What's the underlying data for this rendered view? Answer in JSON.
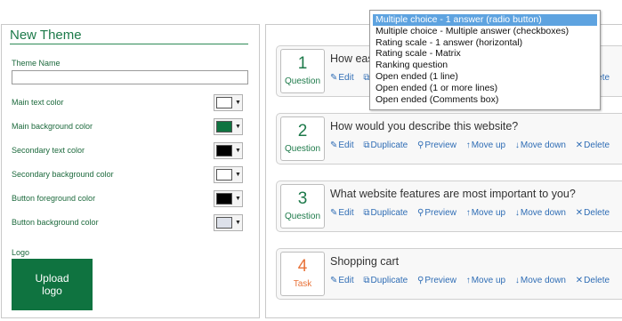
{
  "theme_panel": {
    "title": "New Theme",
    "theme_name_label": "Theme Name",
    "theme_name_value": "",
    "color_settings": [
      {
        "label": "Main text color",
        "color": "#ffffff"
      },
      {
        "label": "Main background color",
        "color": "#0f7340"
      },
      {
        "label": "Secondary text color",
        "color": "#000000"
      },
      {
        "label": "Secondary background color",
        "color": "#ffffff"
      },
      {
        "label": "Button foreground color",
        "color": "#000000"
      },
      {
        "label": "Button background color",
        "color": "#dde1ea"
      }
    ],
    "logo_label": "Logo",
    "upload_button_label": "Upload\nlogo"
  },
  "questions": [
    {
      "number": "1",
      "type": "Question",
      "text": "How easy was it to find what you were looking for",
      "accent": "#1d7a4a"
    },
    {
      "number": "2",
      "type": "Question",
      "text": "How would you describe this website?",
      "accent": "#1d7a4a"
    },
    {
      "number": "3",
      "type": "Question",
      "text": "What website features are most important to you?",
      "accent": "#1d7a4a"
    },
    {
      "number": "4",
      "type": "Task",
      "text": "Shopping cart",
      "accent": "#e8733a"
    }
  ],
  "actions": {
    "edit": "Edit",
    "duplicate": "Duplicate",
    "preview": "Preview",
    "move_up": "Move up",
    "move_down": "Move down",
    "delete": "Delete"
  },
  "action_icons": [
    "pencil-icon",
    "copy-icon",
    "magnifier-icon",
    "arrow-up-icon",
    "arrow-down-icon",
    "x-icon"
  ],
  "question_type_dropdown": {
    "options": [
      "Multiple choice - 1 answer (radio button)",
      "Multiple choice - Multiple answer (checkboxes)",
      "Rating scale - 1 answer (horizontal)",
      "Rating scale - Matrix",
      "Ranking question",
      "Open ended (1 line)",
      "Open ended (1 or more lines)",
      "Open ended (Comments box)"
    ],
    "selected_index": 0
  }
}
